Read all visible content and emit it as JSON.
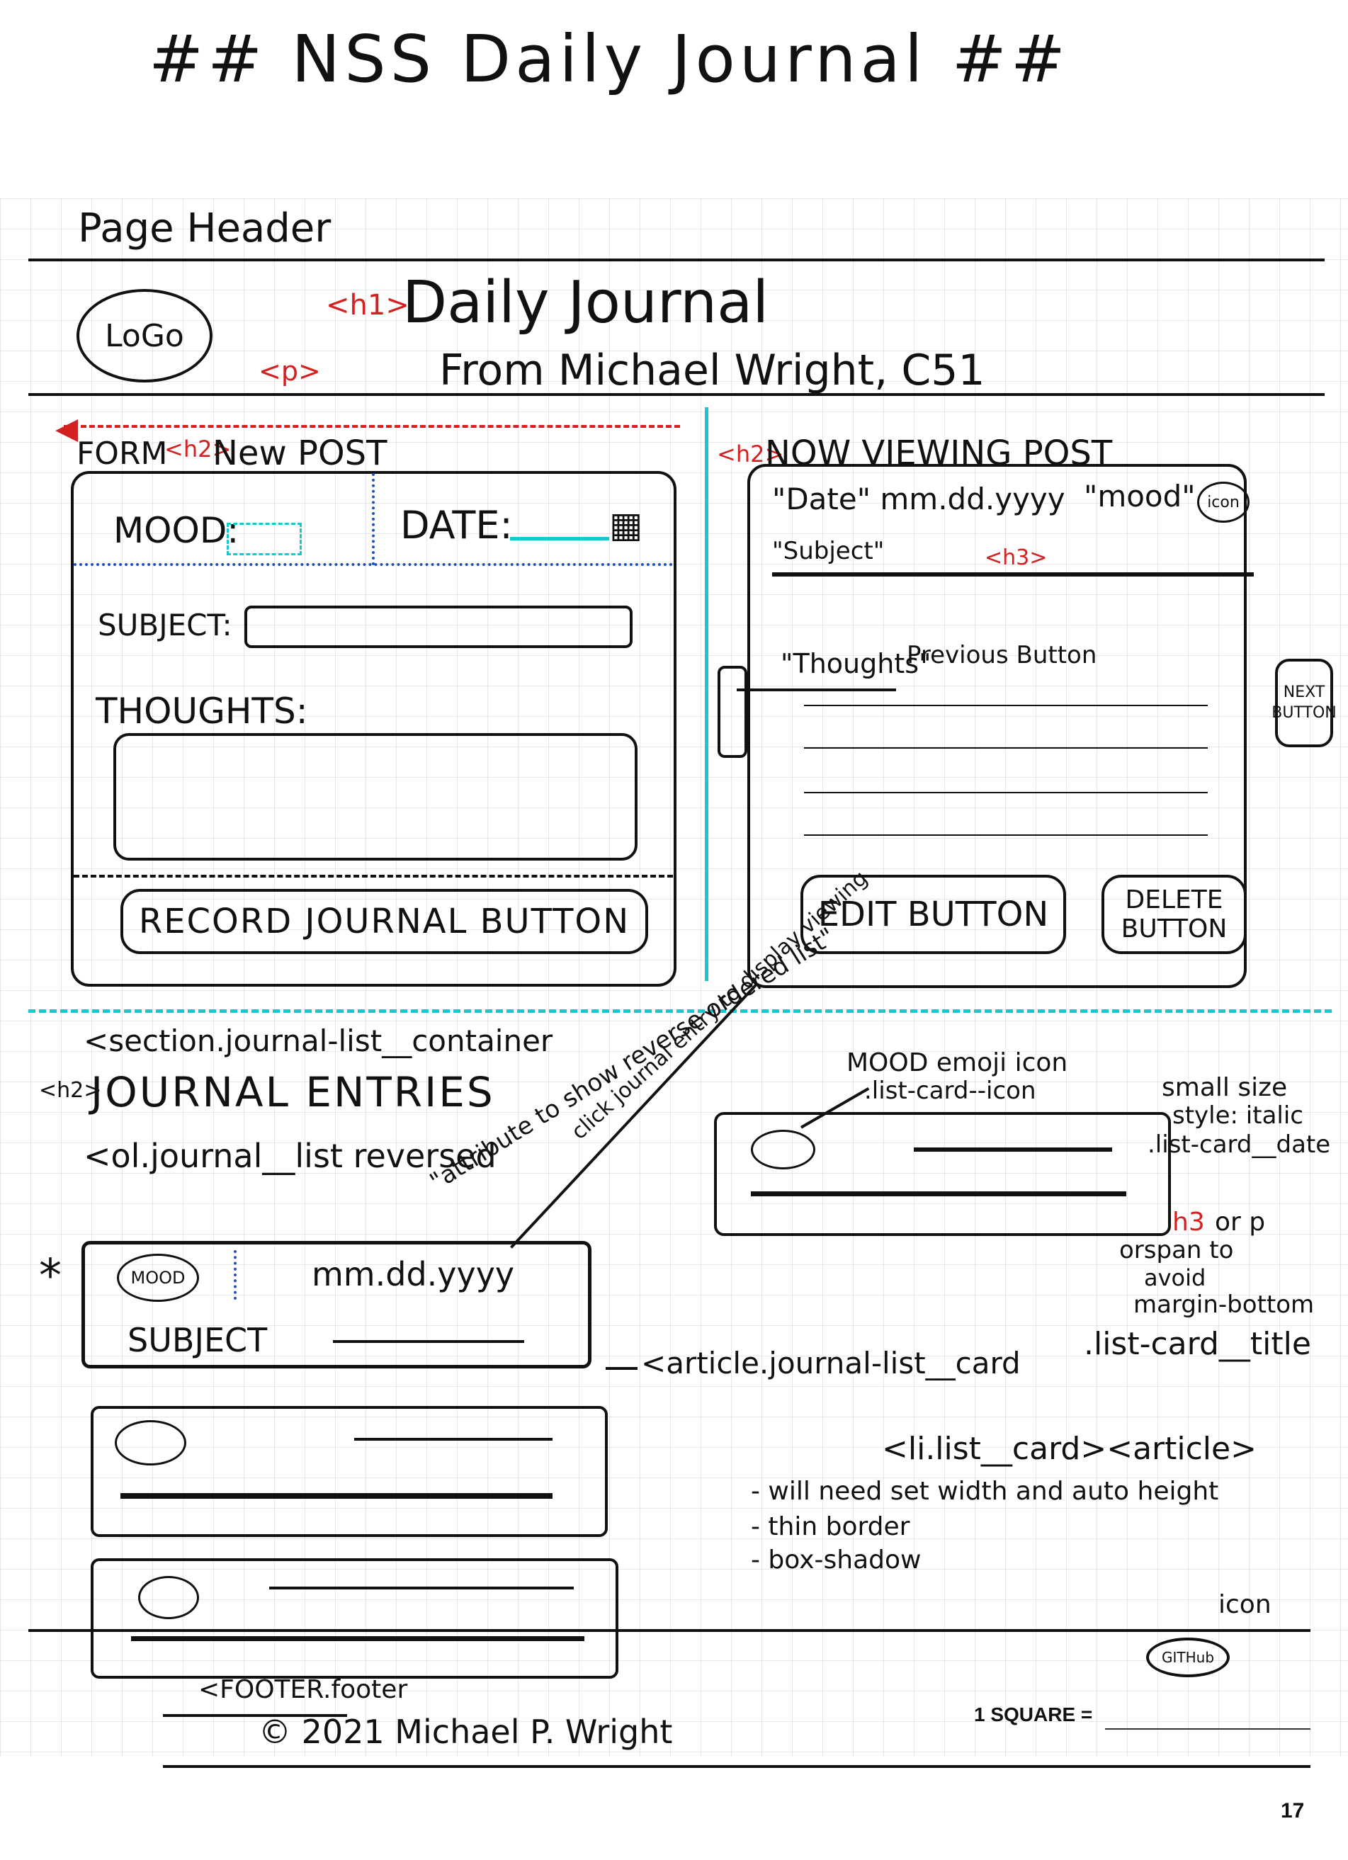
{
  "page_title": "## NSS Daily Journal ##",
  "header": {
    "section_label": "Page Header",
    "logo": "LoGo",
    "h1_tag": "<h1>",
    "h1_text": "Daily Journal",
    "p_tag": "<p>",
    "p_text": "From Michael Wright, C51"
  },
  "form": {
    "label": "FORM",
    "tag": "<h2>",
    "heading": "New POST",
    "mood_label": "MOOD:",
    "date_label": "DATE:",
    "subject_label": "SUBJECT:",
    "thoughts_label": "THOUGHTS:",
    "record_button": "RECORD JOURNAL BUTTON"
  },
  "viewer": {
    "tag": "<h2>",
    "heading": "NOW VIEWING POST",
    "date_label": "\"Date\" mm.dd.yyyy",
    "mood_label": "\"mood\"",
    "mood_icon": "icon",
    "subject_label": "\"Subject\"",
    "subject_tag": "<h3>",
    "thoughts_label": "\"Thoughts\"",
    "previous_note": "Previous Button",
    "next_button": "NEXT BUTTON",
    "edit_button": "EDIT BUTTON",
    "delete_button": "DELETE BUTTON"
  },
  "journal_list": {
    "section_tag": "<section.journal-list__container",
    "h2_tag": "<h2>",
    "heading": "JOURNAL ENTRIES",
    "ol_tag": "<ol.journal__list reversed",
    "attribute_note": "\"attribute to show reverse ordered list\"",
    "click_note": "click journal entry to display viewing",
    "first_card": {
      "mood": "MOOD",
      "date": "mm.dd.yyyy",
      "subject": "SUBJECT"
    },
    "article_note": "<article.journal-list__card",
    "star": "*"
  },
  "card_annotations": {
    "mood_icon_note": "MOOD emoji icon",
    "mood_icon_class": ".list-card--icon",
    "date_note_1": "small size",
    "date_note_2": "style: italic",
    "date_class": ".list-card__date",
    "title_tag": "h3",
    "title_note_1": "or p",
    "title_note_2": "orspan to",
    "title_note_3": "avoid",
    "title_note_4": "margin-bottom",
    "title_class": ".list-card__title",
    "li_tag": "<li.list__card><article>",
    "bullets": [
      "- will need set width and auto height",
      "- thin border",
      "- box-shadow"
    ]
  },
  "footer": {
    "icon_note": "icon",
    "github_icon": "GITHub",
    "tag": "<FOOTER.footer",
    "copyright": "© 2021 Michael P. Wright",
    "square_label": "1 SQUARE =",
    "page_number": "17"
  },
  "colors": {
    "ink": "#111111",
    "annotation_red": "#d42020",
    "cyan_marker": "#17c9cf",
    "blue_marker": "#1f4fc4"
  }
}
